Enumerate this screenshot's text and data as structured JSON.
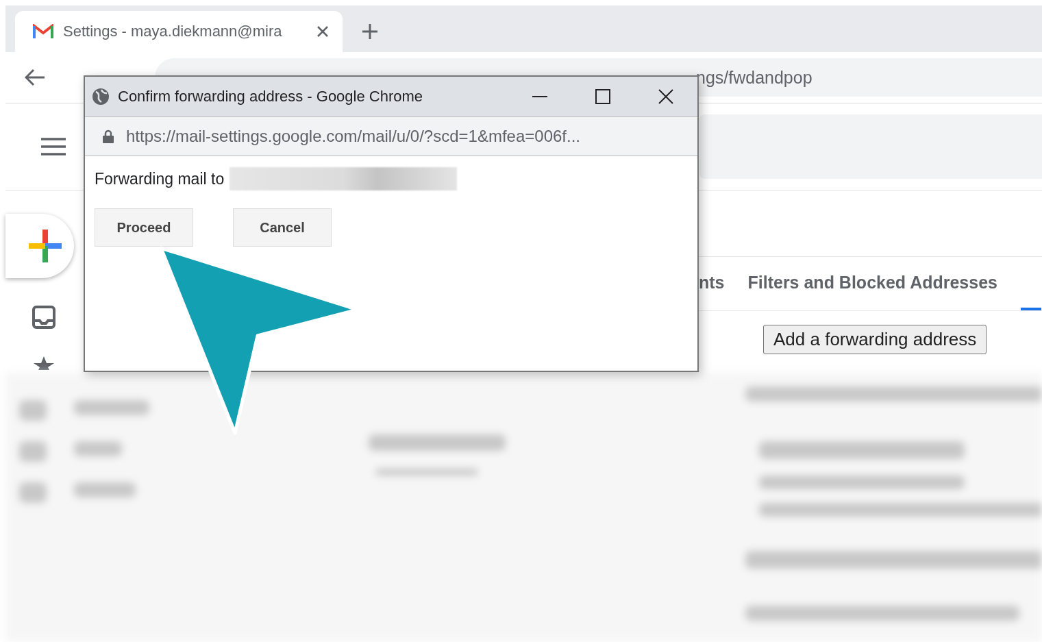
{
  "browser": {
    "tab_title": "Settings - maya.diekmann@mira",
    "address_visible": "ngs/fwdandpop"
  },
  "dialog": {
    "title": "Confirm forwarding address - Google Chrome",
    "url": "https://mail-settings.google.com/mail/u/0/?scd=1&mfea=006f...",
    "message": "Forwarding mail to",
    "buttons": [
      {
        "label": "Proceed"
      },
      {
        "label": "Cancel"
      }
    ]
  },
  "settings_tabs": [
    {
      "label": "nts",
      "selected": false
    },
    {
      "label": "Filters and Blocked Addresses",
      "selected": false
    },
    {
      "selected": true
    }
  ],
  "forwarding_button": "Add a forwarding address"
}
